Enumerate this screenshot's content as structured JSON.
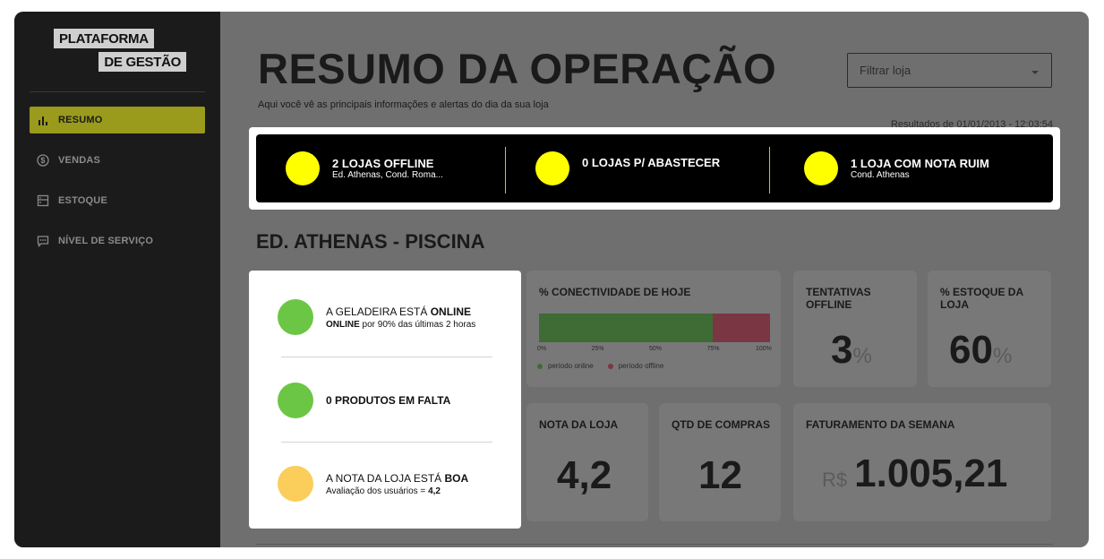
{
  "sidebar": {
    "logo_line1": "PLATAFORMA",
    "logo_line2": "DE GESTÃO",
    "items": [
      {
        "label": "RESUMO",
        "icon": "bar-chart-icon",
        "active": true
      },
      {
        "label": "VENDAS",
        "icon": "dollar-circle-icon",
        "active": false
      },
      {
        "label": "ESTOQUE",
        "icon": "fridge-icon",
        "active": false
      },
      {
        "label": "NÍVEL DE SERVIÇO",
        "icon": "chat-icon",
        "active": false
      }
    ]
  },
  "header": {
    "title": "RESUMO DA OPERAÇÃO",
    "subtitle": "Aqui você vê as principais informações e alertas do dia da sua loja",
    "filter_placeholder": "Filtrar loja",
    "results": "Resultados de 01/01/2013 - 12:03:54"
  },
  "alerts": [
    {
      "title": "2 LOJAS OFFLINE",
      "desc": "Ed. Athenas, Cond. Roma..."
    },
    {
      "title": "0 LOJAS P/ ABASTECER",
      "desc": ""
    },
    {
      "title": "1 LOJA COM NOTA RUIM",
      "desc": "Cond. Athenas"
    }
  ],
  "store": {
    "name": "ED. ATHENAS - PISCINA"
  },
  "status": {
    "fridge": {
      "prefix": "A GELADEIRA ESTÁ ",
      "state": "ONLINE",
      "sub_bold": "ONLINE",
      "sub": " por 90% das últimas 2 horas"
    },
    "products": {
      "title": "0 PRODUTOS EM FALTA"
    },
    "rating": {
      "prefix": "A NOTA DA LOJA ESTÁ ",
      "state": "BOA",
      "sub": "Avaliação dos usuários = ",
      "sub_value": "4,2"
    }
  },
  "cards": {
    "connectivity": {
      "label": "% CONECTIVIDADE DE HOJE"
    },
    "attempts": {
      "label": "TENTATIVAS OFFLINE",
      "value": "3",
      "unit": "%"
    },
    "stock": {
      "label": "% ESTOQUE DA LOJA",
      "value": "60",
      "unit": "%"
    },
    "rating": {
      "label": "NOTA DA LOJA",
      "value": "4,2"
    },
    "purchases": {
      "label": "QTD DE COMPRAS",
      "value": "12"
    },
    "revenue": {
      "label": "FATURAMENTO DA SEMANA",
      "currency": "R$",
      "value": "1.005,21"
    }
  },
  "colors": {
    "online": "#3f6b35",
    "offline": "#7a3642",
    "alert_dot": "#ffff00",
    "ok": "#6cc645",
    "warn": "#fbcd5b"
  },
  "chart_data": {
    "type": "bar",
    "orientation": "horizontal-stacked",
    "title": "% CONECTIVIDADE DE HOJE",
    "xlim": [
      0,
      100
    ],
    "x_ticks": [
      "0%",
      "25%",
      "50%",
      "75%",
      "100%"
    ],
    "series": [
      {
        "name": "período online",
        "values": [
          75
        ]
      },
      {
        "name": "período offline",
        "values": [
          25
        ]
      }
    ],
    "legend": "bottom"
  }
}
